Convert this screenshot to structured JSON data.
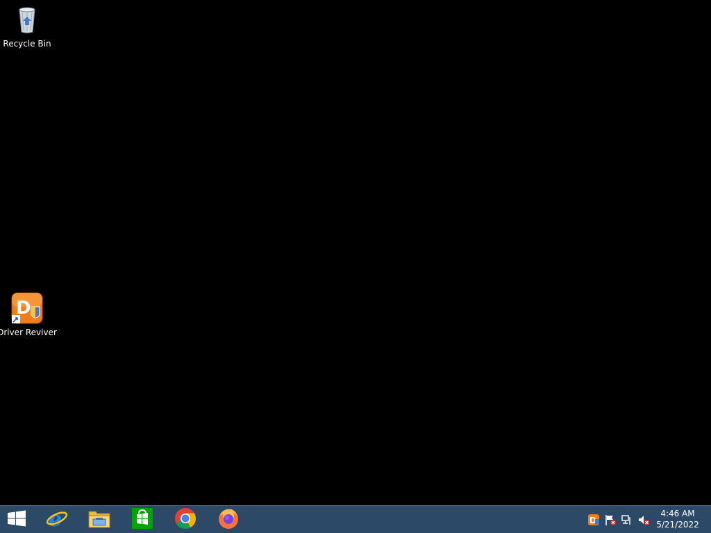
{
  "desktop": {
    "icons": [
      {
        "label": "Recycle Bin",
        "icon": "recycle-bin-icon"
      },
      {
        "label": "Driver Reviver",
        "icon": "driver-reviver-icon"
      }
    ]
  },
  "taskbar": {
    "start_icon": "windows-logo-icon",
    "pinned": [
      {
        "name": "Internet Explorer",
        "icon": "internet-explorer-icon"
      },
      {
        "name": "File Explorer",
        "icon": "file-explorer-icon"
      },
      {
        "name": "Store",
        "icon": "store-icon"
      },
      {
        "name": "Google Chrome",
        "icon": "chrome-icon"
      },
      {
        "name": "Firefox",
        "icon": "firefox-icon"
      }
    ],
    "tray": [
      {
        "icon": "driver-reviver-tray-icon"
      },
      {
        "icon": "action-center-flag-icon"
      },
      {
        "icon": "network-icon"
      },
      {
        "icon": "volume-muted-icon"
      }
    ],
    "clock": {
      "time": "4:46 AM",
      "date": "5/21/2022"
    }
  },
  "colors": {
    "desktop_background": "#000000",
    "taskbar_background": "#2c4a68"
  }
}
